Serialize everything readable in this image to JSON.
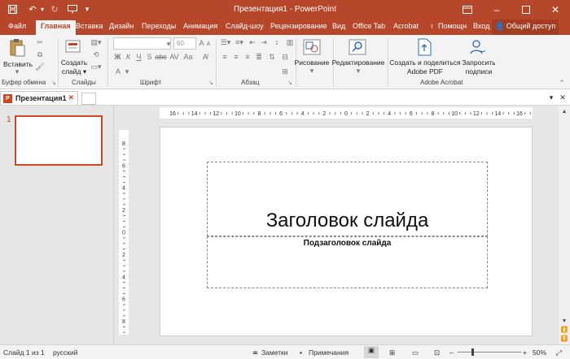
{
  "window": {
    "title": "Презентация1 - PowerPoint",
    "controls": [
      "restore-icon",
      "minimize-icon",
      "maximize-icon",
      "close-icon"
    ]
  },
  "qat": {
    "icons": [
      "save-icon",
      "undo-icon",
      "redo-icon",
      "slideshow-icon",
      "qat-dropdown-icon"
    ]
  },
  "tabs": {
    "file": "Файл",
    "home": "Главная",
    "insert": "Вставка",
    "design": "Дизайн",
    "transitions": "Переходы",
    "animations": "Анимация",
    "slideshow": "Слайд-шоу",
    "review": "Рецензирование",
    "view": "Вид",
    "officetab": "Office Tab",
    "acrobat": "Acrobat",
    "help": "Помощн",
    "signin": "Вход",
    "share": "Общий доступ"
  },
  "ribbon": {
    "clipboard": {
      "paste": "Вставить",
      "group": "Буфер обмена"
    },
    "slides": {
      "new_slide_l1": "Создать",
      "new_slide_l2": "слайд",
      "group": "Слайды"
    },
    "font": {
      "name": "",
      "size": "60",
      "group": "Шрифт"
    },
    "paragraph": {
      "group": "Абзац"
    },
    "drawing": {
      "label": "Рисование"
    },
    "editing": {
      "label": "Редактирование"
    },
    "acrobat": {
      "create_share_l1": "Создать и поделиться",
      "create_share_l2": "Adobe PDF",
      "request_sign_l1": "Запросить",
      "request_sign_l2": "подписи",
      "group": "Adobe Acrobat"
    }
  },
  "doc_tab": {
    "name": "Презентация1",
    "icon_letter": "P"
  },
  "thumbnails": {
    "number": "1"
  },
  "ruler": {
    "h_labels": [
      "16",
      "14",
      "12",
      "10",
      "8",
      "6",
      "4",
      "2",
      "0",
      "2",
      "4",
      "6",
      "8",
      "10",
      "12",
      "14",
      "16"
    ],
    "v_labels": [
      "8",
      "6",
      "4",
      "2",
      "0",
      "2",
      "4",
      "6",
      "8"
    ]
  },
  "slide": {
    "title": "Заголовок слайда",
    "subtitle": "Подзаголовок слайда"
  },
  "status": {
    "slide": "Слайд 1 из 1",
    "language": "русский",
    "notes": "Заметки",
    "comments": "Примечания",
    "zoom": "50%"
  },
  "colors": {
    "accent": "#b7472a",
    "selected_border": "#d24726"
  }
}
